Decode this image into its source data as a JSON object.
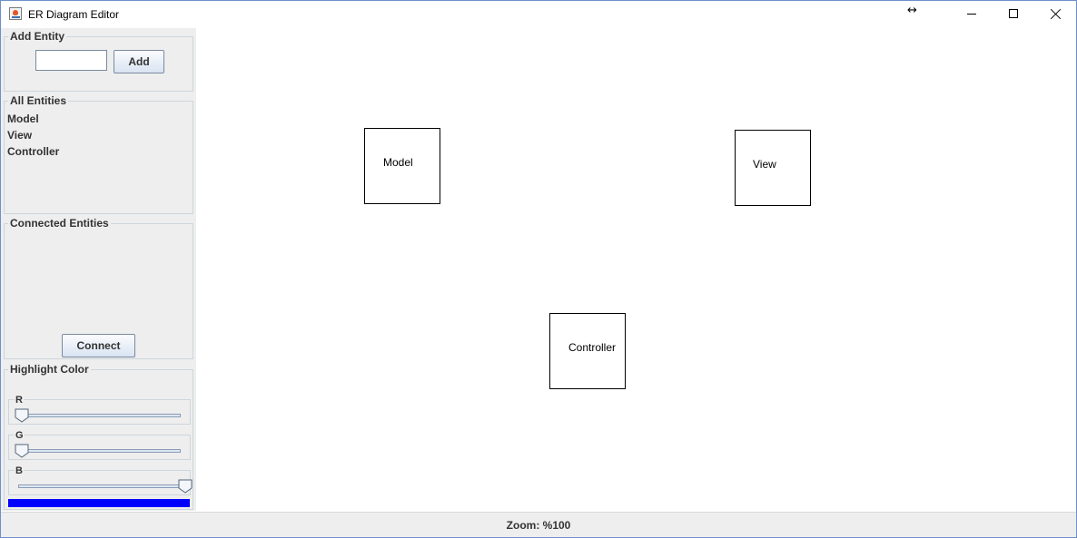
{
  "window": {
    "title": "ER Diagram Editor",
    "icons": {
      "app": "java-cup-icon",
      "cursor": "horizontal-resize-icon"
    },
    "controls": [
      "minimize-icon",
      "maximize-icon",
      "close-icon"
    ]
  },
  "sidebar": {
    "add_entity": {
      "title": "Add Entity",
      "input_value": "",
      "button_label": "Add"
    },
    "all_entities": {
      "title": "All Entities",
      "items": [
        "Model",
        "View",
        "Controller"
      ]
    },
    "connected_entities": {
      "title": "Connected Entities",
      "items": [],
      "button_label": "Connect"
    },
    "highlight_color": {
      "title": "Highlight Color",
      "sliders": [
        {
          "label": "R",
          "value": 0,
          "min": 0,
          "max": 255
        },
        {
          "label": "G",
          "value": 0,
          "min": 0,
          "max": 255
        },
        {
          "label": "B",
          "value": 255,
          "min": 0,
          "max": 255
        }
      ],
      "preview_color": "#0000ff"
    }
  },
  "canvas": {
    "entities": [
      {
        "name": "Model"
      },
      {
        "name": "View"
      },
      {
        "name": "Controller"
      }
    ]
  },
  "status": {
    "zoom": "Zoom: %100"
  }
}
